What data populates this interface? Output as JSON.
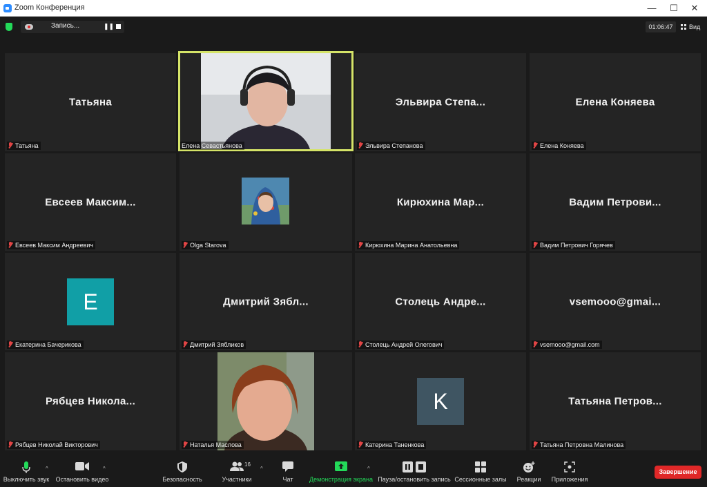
{
  "window": {
    "title": "Zoom Конференция",
    "controls": {
      "minimize": "—",
      "maximize": "☐",
      "close": "✕"
    }
  },
  "topbar": {
    "recording_label": "Запись...",
    "pause_glyph": "❚❚",
    "timer": "01:06:47",
    "view_label": "Вид"
  },
  "tiles": [
    {
      "display_name": "Татьяна",
      "label": "Татьяна",
      "muted": true
    },
    {
      "display_name": "",
      "label": "Елена Севастьянова",
      "muted": false,
      "speaking": true
    },
    {
      "display_name": "Эльвира Степа...",
      "label": "Эльвира Степанова",
      "muted": true
    },
    {
      "display_name": "Елена Коняева",
      "label": "Елена Коняева",
      "muted": true
    },
    {
      "display_name": "Евсеев Максим...",
      "label": "Евсеев Максим Андреевич",
      "muted": true
    },
    {
      "display_name": "",
      "label": "Olga Starova",
      "muted": true
    },
    {
      "display_name": "Кирюхина Мар...",
      "label": "Кирюхина Марина Анатольевна",
      "muted": true
    },
    {
      "display_name": "Вадим Петрови...",
      "label": "Вадим Петрович Горячев",
      "muted": true
    },
    {
      "display_name": "",
      "label": "Екатерина Бачерикова",
      "muted": true,
      "avatar_letter": "E",
      "avatar_color": "#119fa6"
    },
    {
      "display_name": "Дмитрий Зябл...",
      "label": "Дмитрий Зябликов",
      "muted": true
    },
    {
      "display_name": "Столець Андре...",
      "label": "Столець Андрей Олегович",
      "muted": true
    },
    {
      "display_name": "vsemooo@gmai...",
      "label": "vsemooo@gmail.com",
      "muted": true
    },
    {
      "display_name": "Рябцев Никола...",
      "label": "Рябцев Николай Викторович",
      "muted": true
    },
    {
      "display_name": "",
      "label": "Наталья Маслова",
      "muted": true
    },
    {
      "display_name": "",
      "label": "Катерина Таненкова",
      "muted": true,
      "avatar_letter": "K",
      "avatar_color": "#3f5562"
    },
    {
      "display_name": "Татьяна Петров...",
      "label": "Татьяна Петровна Малинова",
      "muted": true
    }
  ],
  "toolbar": {
    "mute_label": "Выключить звук",
    "video_label": "Остановить видео",
    "security_label": "Безопасность",
    "participants_label": "Участники",
    "participants_count": "16",
    "chat_label": "Чат",
    "share_label": "Демонстрация экрана",
    "record_label": "Пауза/остановить запись",
    "breakout_label": "Сессионные залы",
    "reactions_label": "Реакции",
    "apps_label": "Приложения",
    "end_label": "Завершение",
    "caret": "^"
  },
  "colors": {
    "accent_green": "#23d959",
    "active_speaker": "#d5e468",
    "end_red": "#e02828",
    "tile_bg": "#242424"
  }
}
